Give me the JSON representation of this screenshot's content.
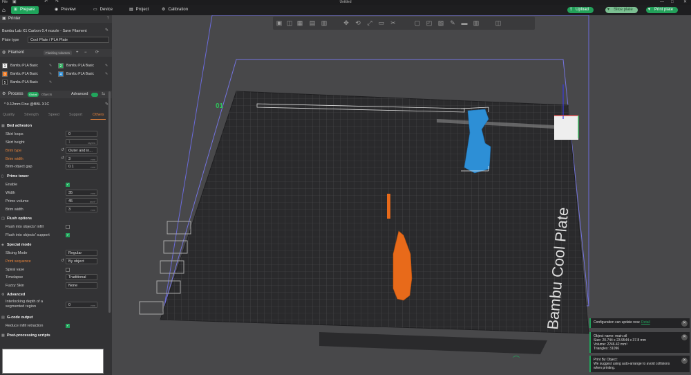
{
  "window": {
    "file_menu": "File",
    "title": "Untitled"
  },
  "topbar": {
    "tabs": [
      {
        "label": "Prepare"
      },
      {
        "label": "Preview"
      },
      {
        "label": "Device"
      },
      {
        "label": "Project"
      },
      {
        "label": "Calibration"
      }
    ],
    "upload": "Upload",
    "slice_plate": "Slice plate",
    "print_plate": "Print plate"
  },
  "printer": {
    "header": "Printer",
    "name": "Bambu Lab X1 Carbon 0.4 nozzle - Save Filament",
    "plate_type_label": "Plate type",
    "plate_type_value": "Cool Plate / PLA Plate"
  },
  "filament": {
    "header": "Filament",
    "badge": "Flushing volumes",
    "slots": [
      {
        "num": "1",
        "name": "Bambu PLA Basic",
        "color": "#f2f2f2"
      },
      {
        "num": "2",
        "name": "Bambu PLA Basic",
        "color": "#2eae5e"
      },
      {
        "num": "3",
        "name": "Bambu PLA Basic",
        "color": "#f07a22"
      },
      {
        "num": "4",
        "name": "Bambu PLA Basic",
        "color": "#2f8fd8"
      },
      {
        "num": "5",
        "name": "Bambu PLA Basic",
        "color": "#222222"
      }
    ]
  },
  "process": {
    "header": "Process",
    "global": "Global",
    "objects": "Objects",
    "advanced": "Advanced",
    "profile": "* 0.12mm Fine @BBL X1C",
    "tabs": [
      "Quality",
      "Strength",
      "Speed",
      "Support",
      "Others"
    ]
  },
  "bed_adhesion": {
    "title": "Bed adhesion",
    "skirt_loops_label": "Skirt loops",
    "skirt_loops": "0",
    "skirt_height_label": "Skirt height",
    "skirt_height": "1",
    "skirt_height_unit": "layers",
    "brim_type_label": "Brim type",
    "brim_type": "Outer and in...",
    "brim_width_label": "Brim width",
    "brim_width": "3",
    "brim_width_unit": "mm",
    "brim_gap_label": "Brim-object gap",
    "brim_gap": "0.1",
    "brim_gap_unit": "mm"
  },
  "prime_tower": {
    "title": "Prime tower",
    "enable_label": "Enable",
    "width_label": "Width",
    "width": "35",
    "width_unit": "mm",
    "volume_label": "Prime volume",
    "volume": "45",
    "volume_unit": "mm³",
    "brim_label": "Brim width",
    "brim": "3",
    "brim_unit": "mm"
  },
  "flush": {
    "title": "Flush options",
    "infill_label": "Flush into objects' infill",
    "support_label": "Flush into objects' support"
  },
  "special": {
    "title": "Special mode",
    "slicing_mode_label": "Slicing Mode",
    "slicing_mode": "Regular",
    "print_seq_label": "Print sequence",
    "print_seq": "By object",
    "spiral_label": "Spiral vase",
    "timelapse_label": "Timelapse",
    "timelapse": "Traditional",
    "fuzzy_label": "Fuzzy Skin",
    "fuzzy": "None"
  },
  "advanced_grp": {
    "title": "Advanced",
    "interlock_label": "Interlocking depth of a",
    "interlock_label2": "segmented region",
    "interlock": "0",
    "interlock_unit": "mm"
  },
  "gcode": {
    "title": "G-code output",
    "reduce_label": "Reduce infill retraction"
  },
  "post": {
    "title": "Post-processing scripts"
  },
  "plate": {
    "label": "Bambu Cool Plate"
  },
  "notifications": {
    "config": "Configuration can update now.",
    "config_link": "Detail",
    "object_name": "Object name: main.stl",
    "size": "Size: 20.744 x 23.9544 x 37.8 mm",
    "volume": "Volume: 2246.42 mm³",
    "triangles": "Triangles: 31096",
    "pbo_title": "Print By Object:",
    "pbo_line1": "We suggest using auto-arrange to avoid collisions",
    "pbo_line2": "when printing."
  }
}
